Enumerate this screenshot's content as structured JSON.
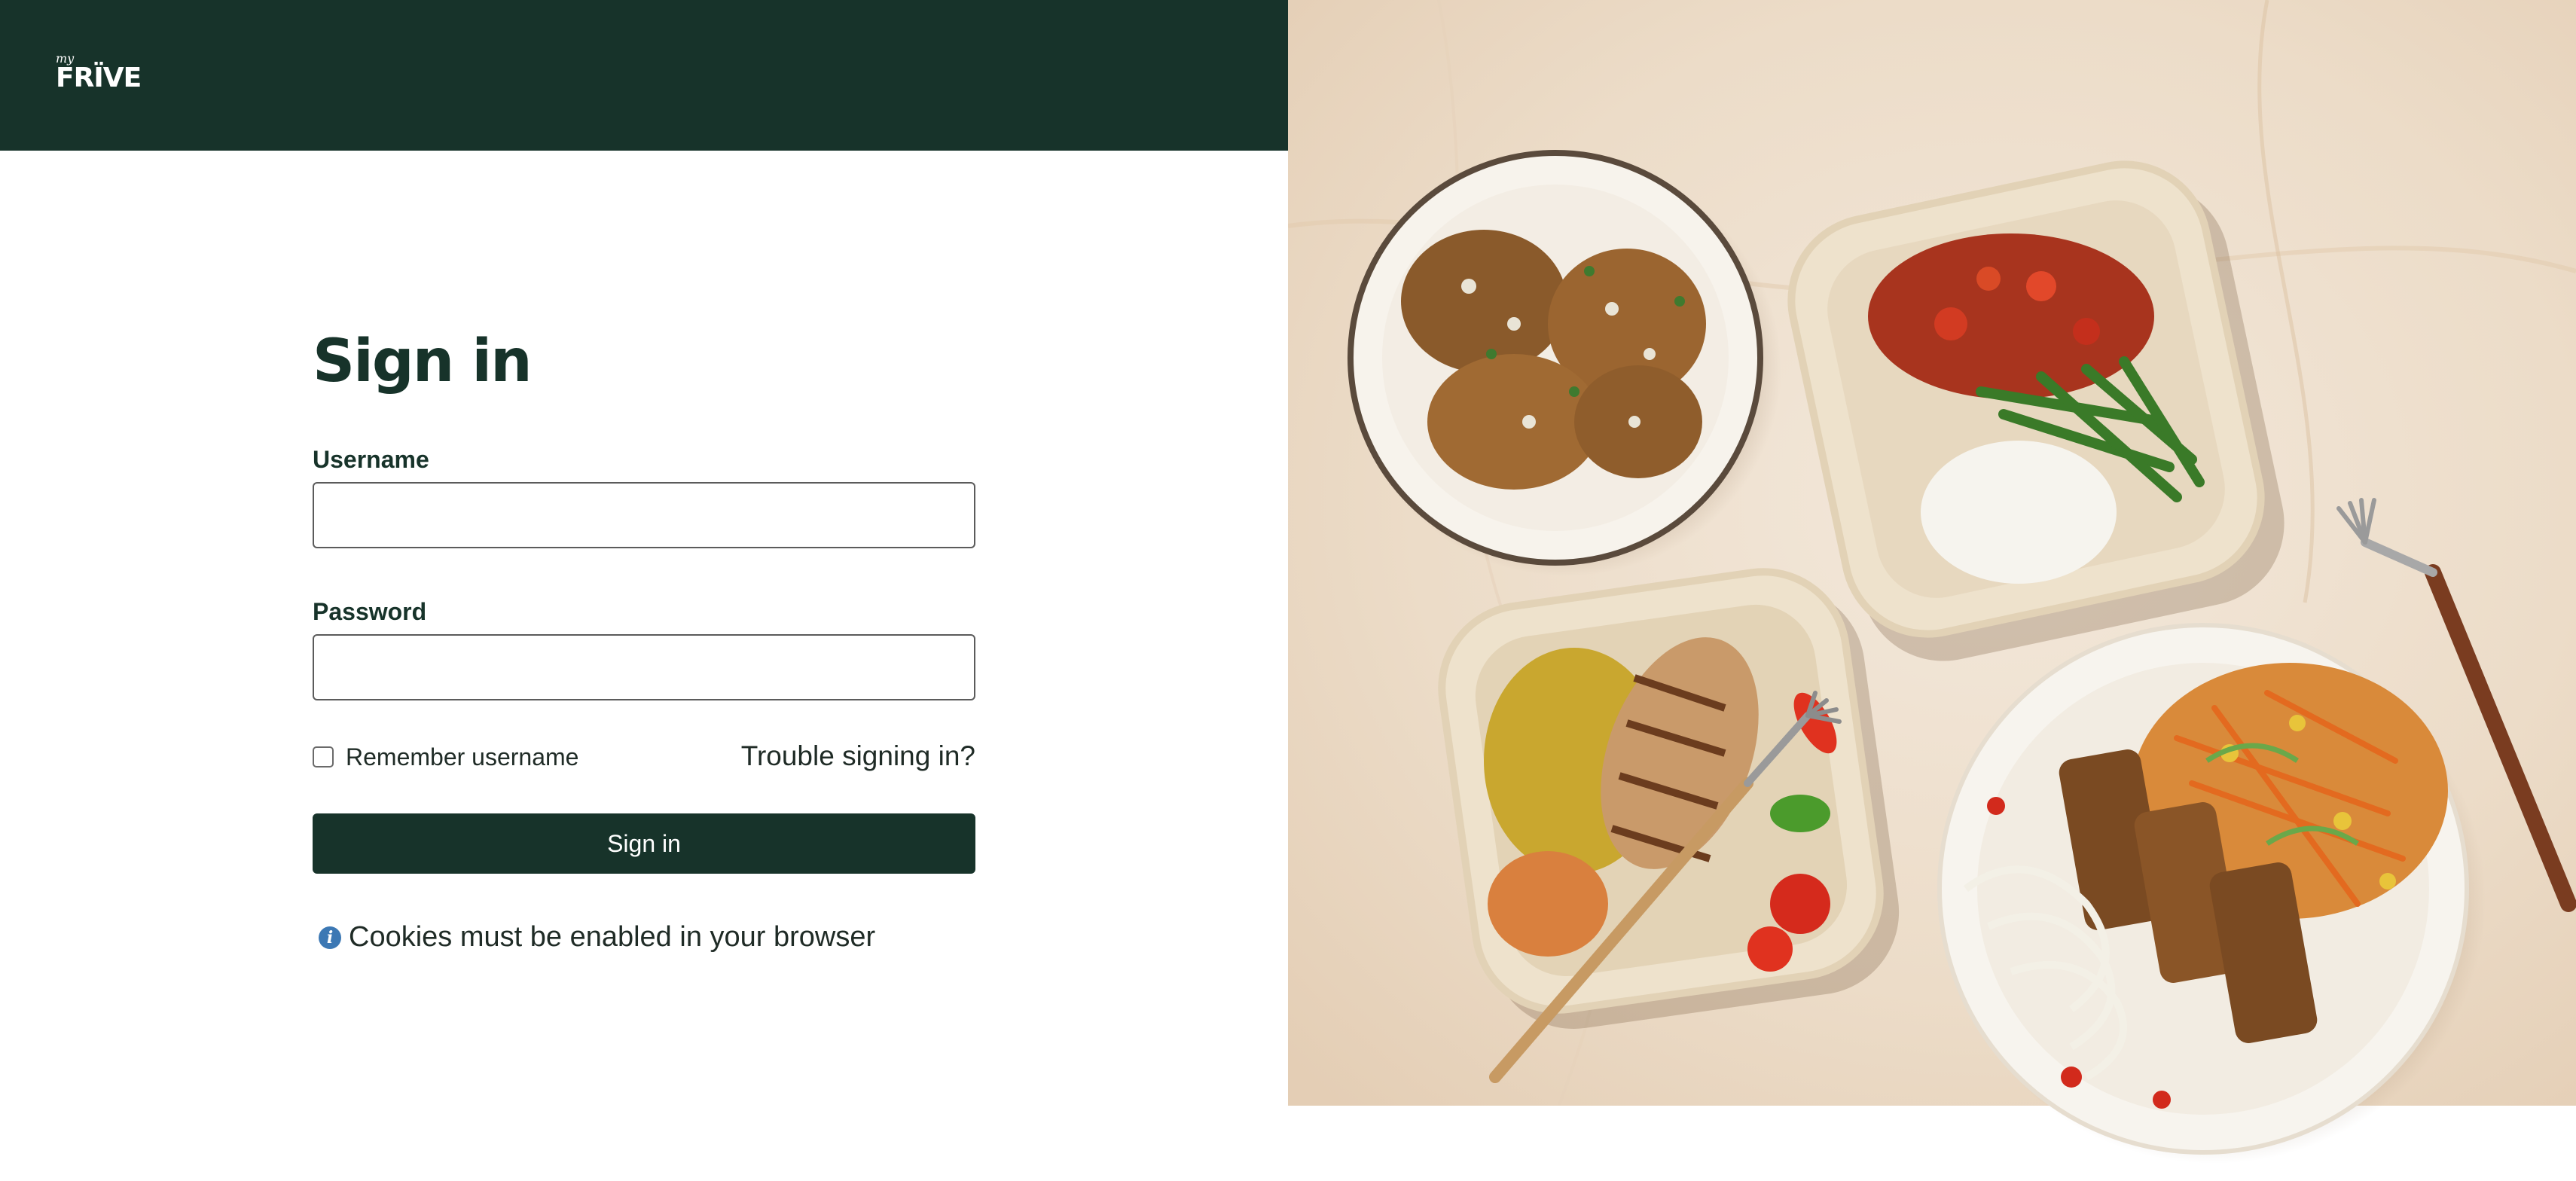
{
  "header": {
    "logo": {
      "prefix": "my",
      "brand": "FRÏVE"
    }
  },
  "signin": {
    "title": "Sign in",
    "username_label": "Username",
    "username_value": "",
    "password_label": "Password",
    "password_value": "",
    "remember_label": "Remember username",
    "remember_checked": false,
    "trouble_link": "Trouble signing in?",
    "submit_label": "Sign in"
  },
  "notice": {
    "icon": "info-icon",
    "text": "Cookies must be enabled in your browser"
  },
  "colors": {
    "brand_dark_green": "#17332a",
    "info_blue": "#3c78b4",
    "marble_background": "#efe3d4"
  },
  "hero_image": {
    "subject": "food-photo",
    "icons": [
      "plate-icon",
      "container-icon",
      "fork-icon"
    ]
  }
}
